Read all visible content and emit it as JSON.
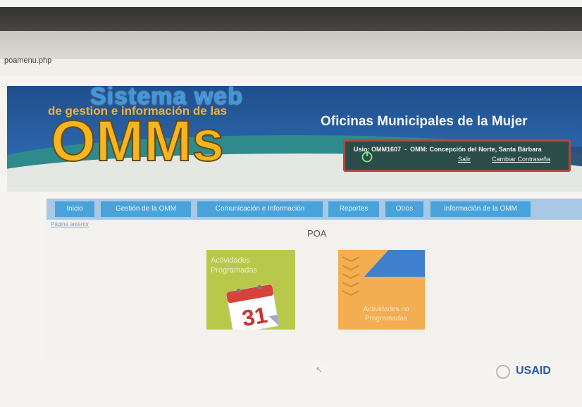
{
  "browser": {
    "url": "poamenu.php"
  },
  "header": {
    "logo_line1": "Sistema web",
    "logo_line2": "de gestion e información de las",
    "logo_line3": "OMMs",
    "site_title": "Oficinas Municipales de la Mujer",
    "user": {
      "prefix": "Us",
      "usuario_label": "io: OMM1607",
      "separator": "-",
      "omm_text": "OMM: Concepción del Norte, Santa Bárbara",
      "logout_link": "Salir",
      "change_password_link": "Cambiar Contraseña"
    }
  },
  "nav": {
    "items": [
      {
        "label": "Inicio"
      },
      {
        "label": "Gestión de la OMM"
      },
      {
        "label": "Comunicación e Información"
      },
      {
        "label": "Reportes"
      },
      {
        "label": "Otros"
      },
      {
        "label": "Información de la OMM"
      }
    ]
  },
  "breadcrumb": {
    "link": "Página anterior"
  },
  "main": {
    "title": "POA",
    "tiles": [
      {
        "label": "Actividades Programadas",
        "calendar_day": "31"
      },
      {
        "label": "Actividades no Programadas"
      }
    ]
  },
  "footer": {
    "sponsor": "USAID"
  },
  "colors": {
    "banner_blue": "#2a63a8",
    "logo_yellow": "#f5b520",
    "nav_blue": "#4aa2da",
    "tile_green": "#b8c84a",
    "tile_orange": "#f3ad52",
    "user_box_border": "#b3473a"
  }
}
